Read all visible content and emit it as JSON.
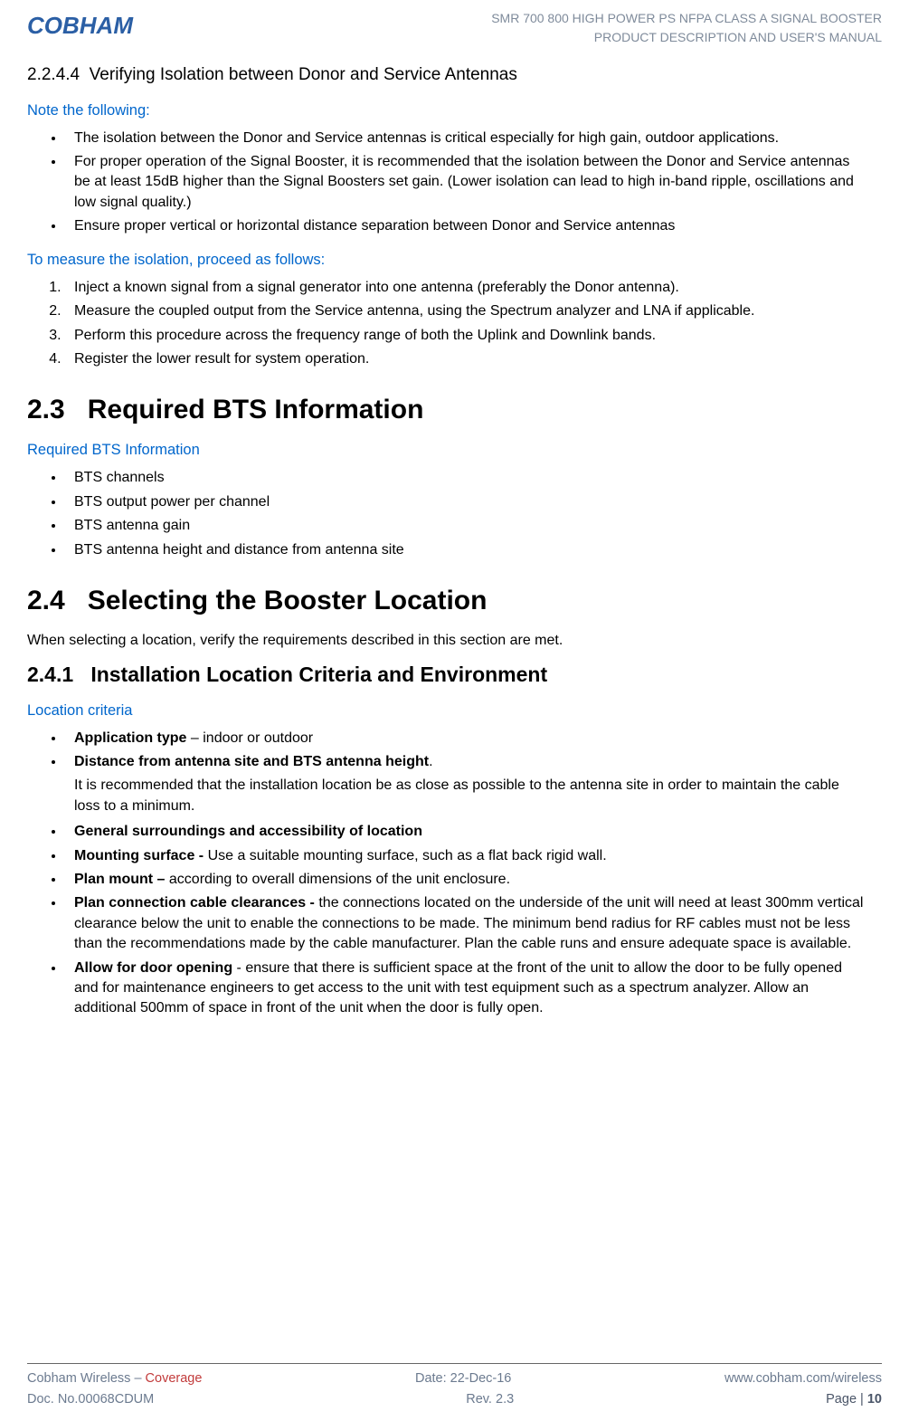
{
  "header": {
    "logo": "COBHAM",
    "line1": "SMR 700 800 HIGH POWER PS NFPA CLASS A SIGNAL BOOSTER",
    "line2": "PRODUCT DESCRIPTION AND USER'S MANUAL"
  },
  "s22_4_4": {
    "number": "2.2.4.4",
    "title": "Verifying Isolation between Donor and Service Antennas",
    "note_heading": "Note the following:",
    "notes": [
      "The isolation between the Donor and Service antennas is critical especially for high gain, outdoor applications.",
      "For proper operation of the Signal Booster, it is recommended that the isolation between the Donor and Service antennas be at least 15dB higher than the Signal Boosters set gain. (Lower isolation can lead to high in-band ripple, oscillations and low signal quality.)",
      "Ensure proper vertical or horizontal distance separation between Donor and Service antennas"
    ],
    "measure_heading": "To measure the isolation, proceed as follows:",
    "steps": [
      "Inject a known signal from a signal generator into one antenna (preferably the Donor antenna).",
      "Measure the coupled output from the Service antenna, using the Spectrum analyzer and LNA if applicable.",
      "Perform this procedure across the frequency range of both the Uplink and Downlink bands.",
      "Register the lower result for system operation."
    ]
  },
  "s23": {
    "number": "2.3",
    "title": "Required BTS Information",
    "sub_heading": "Required BTS Information",
    "items": [
      "BTS channels",
      "BTS output power per channel",
      "BTS antenna gain",
      "BTS antenna height and distance from antenna site"
    ]
  },
  "s24": {
    "number": "2.4",
    "title": "Selecting the Booster Location",
    "intro": "When selecting a location, verify the requirements described in this section are met."
  },
  "s241": {
    "number": "2.4.1",
    "title": "Installation Location Criteria and Environment",
    "sub_heading": "Location criteria",
    "items": [
      {
        "bold": "Application type",
        "sep": " – ",
        "rest": "indoor or outdoor",
        "follow": ""
      },
      {
        "bold": "Distance from antenna site and BTS antenna height",
        "sep": ".",
        "rest": "",
        "follow": "It is recommended that the installation location be as close as possible to the antenna site in order to maintain the cable loss to a minimum."
      },
      {
        "bold": "General surroundings and accessibility of location",
        "sep": "",
        "rest": "",
        "follow": ""
      },
      {
        "bold": "Mounting surface -",
        "sep": " ",
        "rest": "Use a suitable mounting surface, such as a flat back rigid wall.",
        "follow": ""
      },
      {
        "bold": "Plan mount –",
        "sep": " ",
        "rest": "according to overall dimensions of the unit enclosure.",
        "follow": ""
      },
      {
        "bold": "Plan connection cable clearances -",
        "sep": " ",
        "rest": "the connections located on the underside of the unit will need at least 300mm vertical clearance below the unit to enable the connections to be made. The minimum bend radius for RF cables must not be less than the recommendations made by the cable manufacturer. Plan the cable runs and ensure adequate space is available.",
        "follow": ""
      },
      {
        "bold": "Allow for door opening",
        "sep": " - ",
        "rest": "ensure that there is sufficient space at the front of the unit to allow the door to be fully opened and for maintenance engineers to get access to the unit with test equipment such as a spectrum analyzer. Allow an additional 500mm of space in front of the unit when the door is fully open.",
        "follow": ""
      }
    ]
  },
  "footer": {
    "company": "Cobham Wireless",
    "dash": " – ",
    "coverage": "Coverage",
    "date_label": "Date: ",
    "date": "22-Dec-16",
    "url": "www.cobham.com/wireless",
    "doc_label": "Doc. No.",
    "doc_num": "00068CDUM",
    "rev_label": "Rev. ",
    "rev": "2.3",
    "page_label": "Page | ",
    "page_num": "10"
  }
}
